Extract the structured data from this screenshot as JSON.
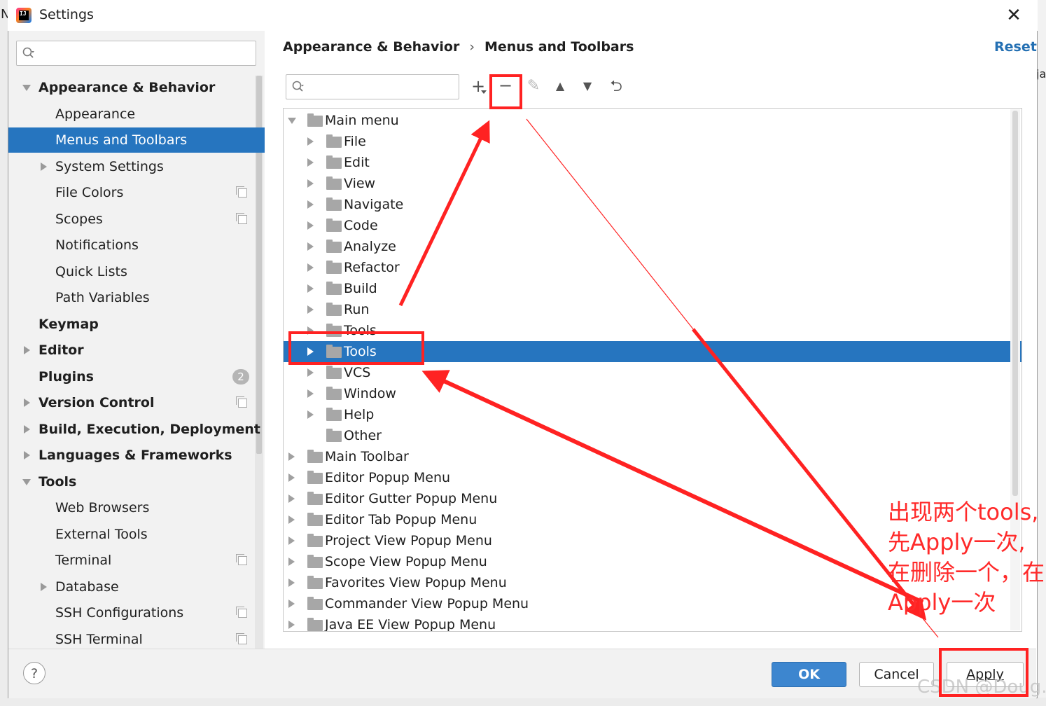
{
  "window": {
    "title": "Settings",
    "close": "✕"
  },
  "background": {
    "left_char": "N",
    "right_char": "ja"
  },
  "sidebar": {
    "search_placeholder": "",
    "items": [
      {
        "label": "Appearance & Behavior",
        "bold": true,
        "expanded": true
      },
      {
        "label": "Appearance"
      },
      {
        "label": "Menus and Toolbars",
        "selected": true
      },
      {
        "label": "System Settings",
        "collapsed": true
      },
      {
        "label": "File Colors"
      },
      {
        "label": "Scopes"
      },
      {
        "label": "Notifications"
      },
      {
        "label": "Quick Lists"
      },
      {
        "label": "Path Variables"
      },
      {
        "label": "Keymap",
        "bold": true
      },
      {
        "label": "Editor",
        "bold": true,
        "collapsed": true
      },
      {
        "label": "Plugins",
        "bold": true,
        "badge": "2"
      },
      {
        "label": "Version Control",
        "bold": true,
        "collapsed": true
      },
      {
        "label": "Build, Execution, Deployment",
        "bold": true,
        "collapsed": true
      },
      {
        "label": "Languages & Frameworks",
        "bold": true,
        "collapsed": true
      },
      {
        "label": "Tools",
        "bold": true,
        "expanded": true
      },
      {
        "label": "Web Browsers"
      },
      {
        "label": "External Tools"
      },
      {
        "label": "Terminal"
      },
      {
        "label": "Database",
        "collapsed": true
      },
      {
        "label": "SSH Configurations"
      },
      {
        "label": "SSH Terminal"
      }
    ]
  },
  "header": {
    "breadcrumb_parent": "Appearance & Behavior",
    "breadcrumb_separator": "›",
    "breadcrumb_current": "Menus and Toolbars",
    "reset": "Reset"
  },
  "toolbar": {
    "search_placeholder": "",
    "add": "+",
    "remove": "−",
    "edit": "✎",
    "move_up": "▲",
    "move_down": "▼",
    "restore": "⮌"
  },
  "action_tree": {
    "rows": [
      {
        "label": "Main menu",
        "expanded": true
      },
      {
        "label": "File"
      },
      {
        "label": "Edit"
      },
      {
        "label": "View"
      },
      {
        "label": "Navigate"
      },
      {
        "label": "Code"
      },
      {
        "label": "Analyze"
      },
      {
        "label": "Refactor"
      },
      {
        "label": "Build"
      },
      {
        "label": "Run"
      },
      {
        "label": "Tools"
      },
      {
        "label": "Tools",
        "selected": true
      },
      {
        "label": "VCS"
      },
      {
        "label": "Window"
      },
      {
        "label": "Help"
      },
      {
        "label": "Other"
      },
      {
        "label": "Main Toolbar"
      },
      {
        "label": "Editor Popup Menu"
      },
      {
        "label": "Editor Gutter Popup Menu"
      },
      {
        "label": "Editor Tab Popup Menu"
      },
      {
        "label": "Project View Popup Menu"
      },
      {
        "label": "Scope View Popup Menu"
      },
      {
        "label": "Favorites View Popup Menu"
      },
      {
        "label": "Commander View Popup Menu"
      },
      {
        "label": "Java EE View Popup Menu"
      }
    ]
  },
  "footer": {
    "help": "?",
    "ok": "OK",
    "cancel": "Cancel",
    "apply": "Apply"
  },
  "annotation": {
    "line1": "出现两个tools,",
    "line2": "先Apply一次,",
    "line3": "在删除一个，在",
    "line4": "Apply一次",
    "color": "#ff2a2a"
  },
  "watermark": "CSDN @Doug..."
}
